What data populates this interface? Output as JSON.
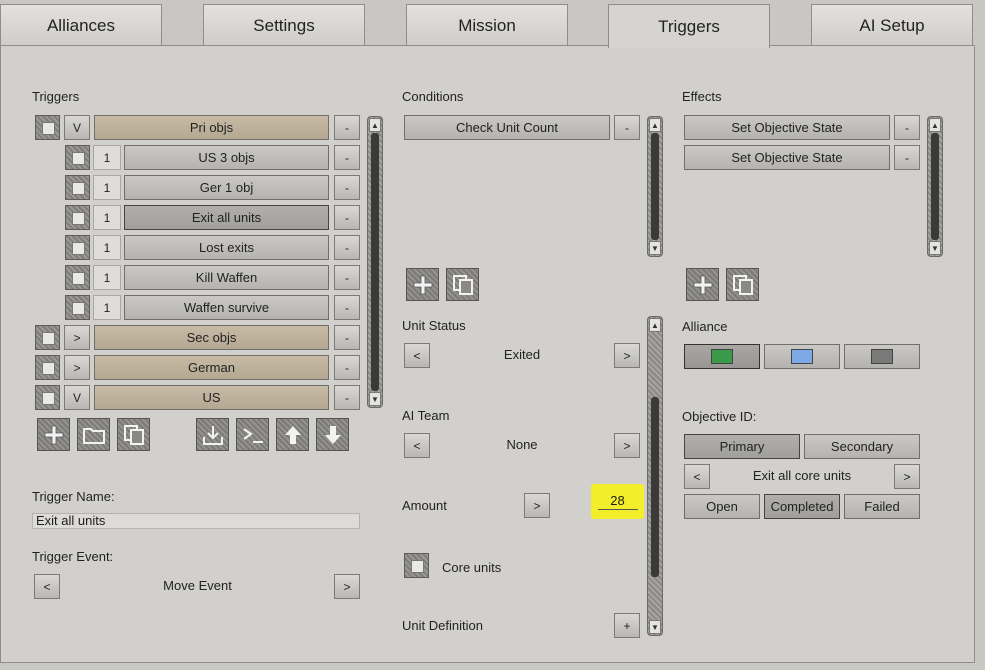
{
  "tabs": [
    "Alliances",
    "Settings",
    "Mission",
    "Triggers",
    "AI Setup"
  ],
  "triggers": {
    "label": "Triggers",
    "rows": [
      {
        "toggle": "V",
        "label": "Pri objs"
      },
      {
        "num": "1",
        "label": "US 3 objs"
      },
      {
        "num": "1",
        "label": "Ger 1 obj"
      },
      {
        "num": "1",
        "label": "Exit all units"
      },
      {
        "num": "1",
        "label": "Lost exits"
      },
      {
        "num": "1",
        "label": "Kill Waffen"
      },
      {
        "num": "1",
        "label": "Waffen survive"
      },
      {
        "toggle": ">",
        "label": "Sec objs"
      },
      {
        "toggle": ">",
        "label": "German"
      },
      {
        "toggle": "V",
        "label": "US"
      }
    ],
    "remove_label": "-",
    "name_label": "Trigger Name:",
    "name_value": "Exit all units",
    "event_label": "Trigger Event:",
    "event_value": "Move Event",
    "prev": "<",
    "next": ">"
  },
  "conditions": {
    "label": "Conditions",
    "items": [
      "Check Unit Count"
    ],
    "unit_status_label": "Unit Status",
    "unit_status_value": "Exited",
    "ai_team_label": "AI Team",
    "ai_team_value": "None",
    "amount_label": "Amount",
    "amount_value": "28",
    "amount_btn": ">",
    "core_units_label": "Core units",
    "unit_definition_label": "Unit Definition",
    "plus": "+"
  },
  "effects": {
    "label": "Effects",
    "items": [
      "Set Objective State",
      "Set Objective State"
    ],
    "alliance_label": "Alliance",
    "alliance_colors": [
      "#3a9a4a",
      "#7ea8e6",
      "#7a7a7a"
    ],
    "objective_label": "Objective ID:",
    "primary": "Primary",
    "secondary": "Secondary",
    "objective_value": "Exit all core units",
    "states": [
      "Open",
      "Completed",
      "Failed"
    ]
  }
}
